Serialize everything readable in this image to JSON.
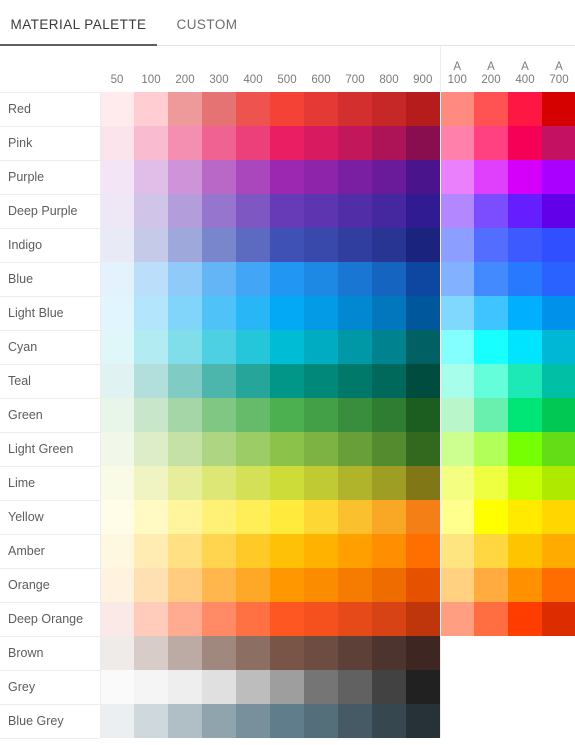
{
  "tabs": [
    {
      "id": "material",
      "label": "MATERIAL PALETTE",
      "active": true
    },
    {
      "id": "custom",
      "label": "CUSTOM",
      "active": false
    }
  ],
  "theme": {
    "active_tab_underline": "#5f5f5f",
    "active_tab_text": "#3a3a3a",
    "inactive_tab_text": "#6d6d6d",
    "grid_line": "#ededed",
    "background": "#ffffff"
  },
  "table": {
    "shade_headers": [
      "50",
      "100",
      "200",
      "300",
      "400",
      "500",
      "600",
      "700",
      "800",
      "900"
    ],
    "accent_headers": [
      {
        "prefix": "A",
        "value": "100"
      },
      {
        "prefix": "A",
        "value": "200"
      },
      {
        "prefix": "A",
        "value": "400"
      },
      {
        "prefix": "A",
        "value": "700"
      }
    ],
    "rows": [
      {
        "name": "Red",
        "shades": [
          "#ffebee",
          "#ffcdd2",
          "#ef9a9a",
          "#e57373",
          "#ef5350",
          "#f44336",
          "#e53935",
          "#d32f2f",
          "#c62828",
          "#b71c1c"
        ],
        "accents": [
          "#ff8a80",
          "#ff5252",
          "#ff1744",
          "#d50000"
        ]
      },
      {
        "name": "Pink",
        "shades": [
          "#fce4ec",
          "#f8bbd0",
          "#f48fb1",
          "#f06292",
          "#ec407a",
          "#e91e63",
          "#d81b60",
          "#c2185b",
          "#ad1457",
          "#880e4f"
        ],
        "accents": [
          "#ff80ab",
          "#ff4081",
          "#f50057",
          "#c51162"
        ]
      },
      {
        "name": "Purple",
        "shades": [
          "#f3e5f5",
          "#e1bee7",
          "#ce93d8",
          "#ba68c8",
          "#ab47bc",
          "#9c27b0",
          "#8e24aa",
          "#7b1fa2",
          "#6a1b9a",
          "#4a148c"
        ],
        "accents": [
          "#ea80fc",
          "#e040fb",
          "#d500f9",
          "#aa00ff"
        ]
      },
      {
        "name": "Deep Purple",
        "shades": [
          "#ede7f6",
          "#d1c4e9",
          "#b39ddb",
          "#9575cd",
          "#7e57c2",
          "#673ab7",
          "#5e35b1",
          "#512da8",
          "#4527a0",
          "#311b92"
        ],
        "accents": [
          "#b388ff",
          "#7c4dff",
          "#651fff",
          "#6200ea"
        ]
      },
      {
        "name": "Indigo",
        "shades": [
          "#e8eaf6",
          "#c5cae9",
          "#9fa8da",
          "#7986cb",
          "#5c6bc0",
          "#3f51b5",
          "#3949ab",
          "#303f9f",
          "#283593",
          "#1a237e"
        ],
        "accents": [
          "#8c9eff",
          "#536dfe",
          "#3d5afe",
          "#304ffe"
        ]
      },
      {
        "name": "Blue",
        "shades": [
          "#e3f2fd",
          "#bbdefb",
          "#90caf9",
          "#64b5f6",
          "#42a5f5",
          "#2196f3",
          "#1e88e5",
          "#1976d2",
          "#1565c0",
          "#0d47a1"
        ],
        "accents": [
          "#82b1ff",
          "#448aff",
          "#2979ff",
          "#2962ff"
        ]
      },
      {
        "name": "Light Blue",
        "shades": [
          "#e1f5fe",
          "#b3e5fc",
          "#81d4fa",
          "#4fc3f7",
          "#29b6f6",
          "#03a9f4",
          "#039be5",
          "#0288d1",
          "#0277bd",
          "#01579b"
        ],
        "accents": [
          "#80d8ff",
          "#40c4ff",
          "#00b0ff",
          "#0091ea"
        ]
      },
      {
        "name": "Cyan",
        "shades": [
          "#e0f7fa",
          "#b2ebf2",
          "#80deea",
          "#4dd0e1",
          "#26c6da",
          "#00bcd4",
          "#00acc1",
          "#0097a7",
          "#00838f",
          "#006064"
        ],
        "accents": [
          "#84ffff",
          "#18ffff",
          "#00e5ff",
          "#00b8d4"
        ]
      },
      {
        "name": "Teal",
        "shades": [
          "#e0f2f1",
          "#b2dfdb",
          "#80cbc4",
          "#4db6ac",
          "#26a69a",
          "#009688",
          "#00897b",
          "#00796b",
          "#00695c",
          "#004d40"
        ],
        "accents": [
          "#a7ffeb",
          "#64ffda",
          "#1de9b6",
          "#00bfa5"
        ]
      },
      {
        "name": "Green",
        "shades": [
          "#e8f5e9",
          "#c8e6c9",
          "#a5d6a7",
          "#81c784",
          "#66bb6a",
          "#4caf50",
          "#43a047",
          "#388e3c",
          "#2e7d32",
          "#1b5e20"
        ],
        "accents": [
          "#b9f6ca",
          "#69f0ae",
          "#00e676",
          "#00c853"
        ]
      },
      {
        "name": "Light Green",
        "shades": [
          "#f1f8e9",
          "#dcedc8",
          "#c5e1a5",
          "#aed581",
          "#9ccc65",
          "#8bc34a",
          "#7cb342",
          "#689f38",
          "#558b2f",
          "#33691e"
        ],
        "accents": [
          "#ccff90",
          "#b2ff59",
          "#76ff03",
          "#64dd17"
        ]
      },
      {
        "name": "Lime",
        "shades": [
          "#f9fbe7",
          "#f0f4c3",
          "#e6ee9c",
          "#dce775",
          "#d4e157",
          "#cddc39",
          "#c0ca33",
          "#afb42b",
          "#9e9d24",
          "#827717"
        ],
        "accents": [
          "#f4ff81",
          "#eeff41",
          "#c6ff00",
          "#aeea00"
        ]
      },
      {
        "name": "Yellow",
        "shades": [
          "#fffde7",
          "#fff9c4",
          "#fff59d",
          "#fff176",
          "#ffee58",
          "#ffeb3b",
          "#fdd835",
          "#fbc02d",
          "#f9a825",
          "#f57f17"
        ],
        "accents": [
          "#ffff8d",
          "#ffff00",
          "#ffea00",
          "#ffd600"
        ]
      },
      {
        "name": "Amber",
        "shades": [
          "#fff8e1",
          "#ffecb3",
          "#ffe082",
          "#ffd54f",
          "#ffca28",
          "#ffc107",
          "#ffb300",
          "#ffa000",
          "#ff8f00",
          "#ff6f00"
        ],
        "accents": [
          "#ffe57f",
          "#ffd740",
          "#ffc400",
          "#ffab00"
        ]
      },
      {
        "name": "Orange",
        "shades": [
          "#fff3e0",
          "#ffe0b2",
          "#ffcc80",
          "#ffb74d",
          "#ffa726",
          "#ff9800",
          "#fb8c00",
          "#f57c00",
          "#ef6c00",
          "#e65100"
        ],
        "accents": [
          "#ffd180",
          "#ffab40",
          "#ff9100",
          "#ff6d00"
        ]
      },
      {
        "name": "Deep Orange",
        "shades": [
          "#fbe9e7",
          "#ffccbc",
          "#ffab91",
          "#ff8a65",
          "#ff7043",
          "#ff5722",
          "#f4511e",
          "#e64a19",
          "#d84315",
          "#bf360c"
        ],
        "accents": [
          "#ff9e80",
          "#ff6e40",
          "#ff3d00",
          "#dd2c00"
        ]
      },
      {
        "name": "Brown",
        "shades": [
          "#efebe9",
          "#d7ccc8",
          "#bcaaa4",
          "#a1887f",
          "#8d6e63",
          "#795548",
          "#6d4c41",
          "#5d4037",
          "#4e342e",
          "#3e2723"
        ],
        "accents": []
      },
      {
        "name": "Grey",
        "shades": [
          "#fafafa",
          "#f5f5f5",
          "#eeeeee",
          "#e0e0e0",
          "#bdbdbd",
          "#9e9e9e",
          "#757575",
          "#616161",
          "#424242",
          "#212121"
        ],
        "accents": []
      },
      {
        "name": "Blue Grey",
        "shades": [
          "#eceff1",
          "#cfd8dc",
          "#b0bec5",
          "#90a4ae",
          "#78909c",
          "#607d8b",
          "#546e7a",
          "#455a64",
          "#37474f",
          "#263238"
        ],
        "accents": []
      }
    ]
  }
}
